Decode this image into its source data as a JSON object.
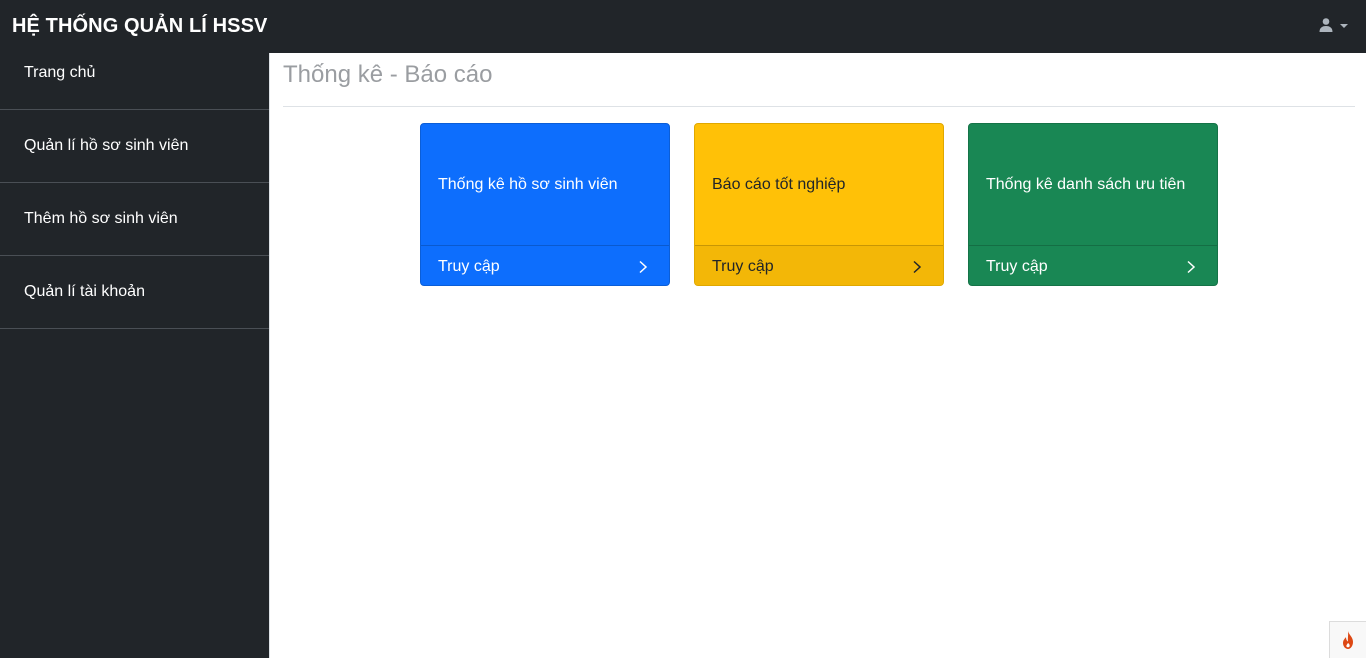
{
  "app": {
    "title": "HỆ THỐNG QUẢN LÍ HSSV"
  },
  "header": {
    "user_icon": "user-icon",
    "menu_icon": "caret-down-icon"
  },
  "sidebar": {
    "items": [
      {
        "label": "Trang chủ"
      },
      {
        "label": "Quản lí hồ sơ sinh viên"
      },
      {
        "label": "Thêm hồ sơ sinh viên"
      },
      {
        "label": "Quản lí tài khoản"
      }
    ]
  },
  "main": {
    "title": "Thống kê - Báo cáo",
    "cards": [
      {
        "title": "Thống kê hồ sơ sinh viên",
        "link_label": "Truy cập",
        "color": "#0d6efd"
      },
      {
        "title": "Báo cáo tốt nghiệp",
        "link_label": "Truy cập",
        "color": "#ffc107"
      },
      {
        "title": "Thống kê danh sách ưu tiên",
        "link_label": "Truy cập",
        "color": "#198754"
      }
    ]
  },
  "debug_toolbar": {
    "icon": "flame-icon",
    "color": "#dd4814"
  }
}
